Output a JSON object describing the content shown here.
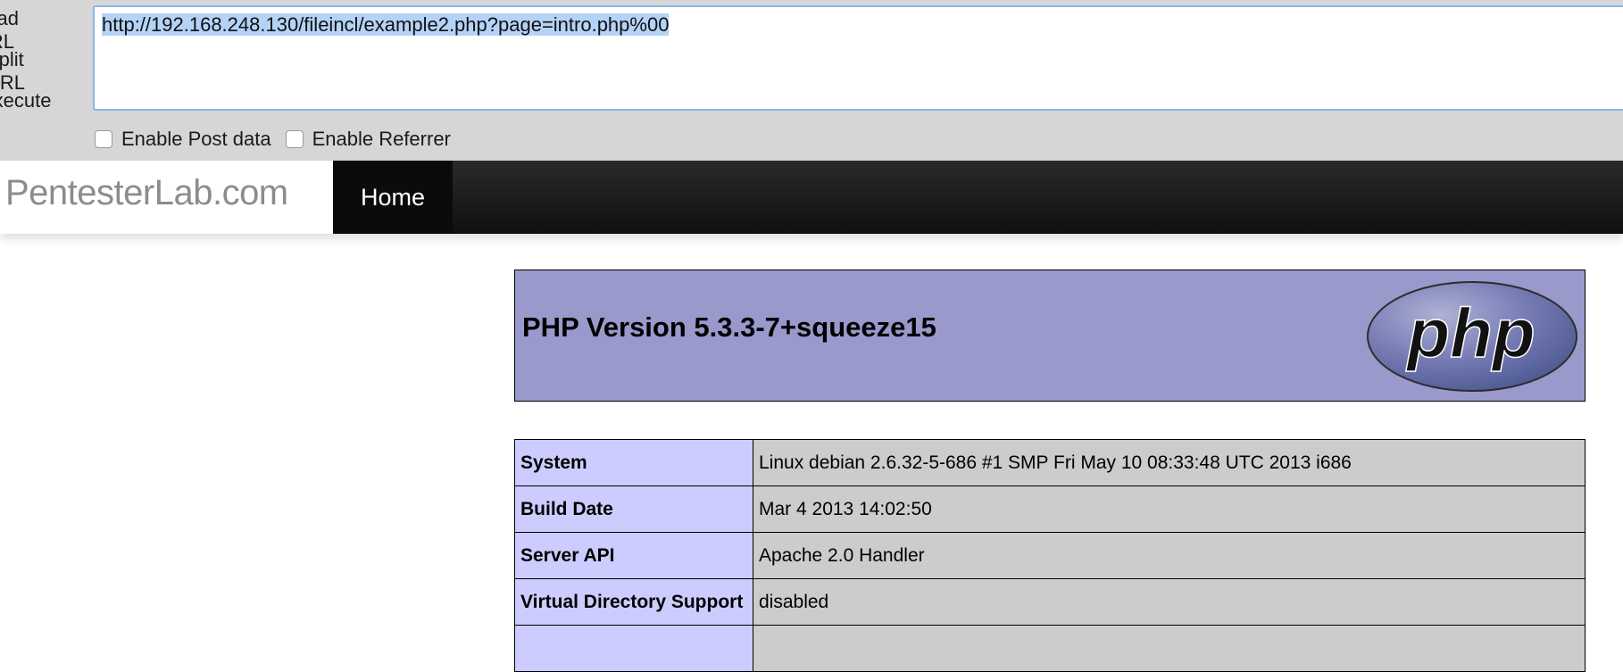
{
  "hackbar": {
    "actions": {
      "load_url": "Load URL",
      "split_url": "Split URL",
      "execute": "Execute"
    },
    "url": "http://192.168.248.130/fileincl/example2.php?page=intro.php%00",
    "options": {
      "enable_post": "Enable Post data",
      "enable_referrer": "Enable Referrer"
    }
  },
  "site": {
    "brand": "PentesterLab.com",
    "nav_home": "Home"
  },
  "phpinfo": {
    "title": "PHP Version 5.3.3-7+squeeze15",
    "logo_text": "php",
    "rows": [
      {
        "key": "System",
        "value": "Linux debian 2.6.32-5-686 #1 SMP Fri May 10 08:33:48 UTC 2013 i686"
      },
      {
        "key": "Build Date",
        "value": "Mar 4 2013 14:02:50"
      },
      {
        "key": "Server API",
        "value": "Apache 2.0 Handler"
      },
      {
        "key": "Virtual Directory Support",
        "value": "disabled"
      },
      {
        "key": "",
        "value": ""
      }
    ]
  },
  "colors": {
    "php_header_bg": "#9999cc",
    "key_cell_bg": "#ccccff",
    "value_cell_bg": "#cccccc",
    "url_selection": "#b4d3f7"
  }
}
